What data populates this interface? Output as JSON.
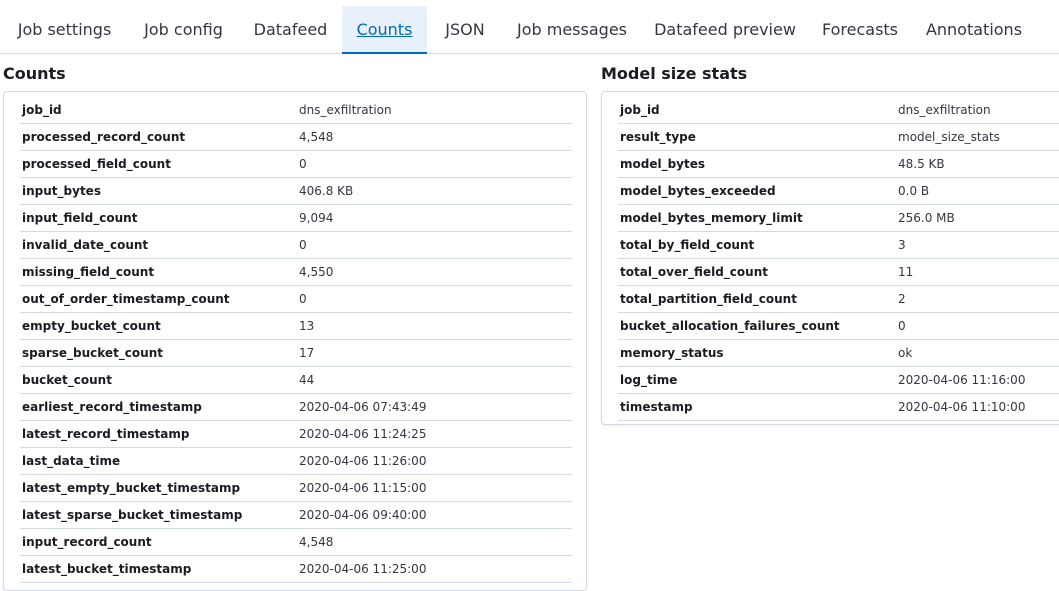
{
  "tabs": [
    {
      "label": "Job settings"
    },
    {
      "label": "Job config"
    },
    {
      "label": "Datafeed"
    },
    {
      "label": "Counts",
      "selected": true
    },
    {
      "label": "JSON"
    },
    {
      "label": "Job messages"
    },
    {
      "label": "Datafeed preview"
    },
    {
      "label": "Forecasts"
    },
    {
      "label": "Annotations"
    }
  ],
  "counts": {
    "title": "Counts",
    "rows": [
      {
        "key": "job_id",
        "value": "dns_exfiltration"
      },
      {
        "key": "processed_record_count",
        "value": "4,548"
      },
      {
        "key": "processed_field_count",
        "value": "0"
      },
      {
        "key": "input_bytes",
        "value": "406.8 KB"
      },
      {
        "key": "input_field_count",
        "value": "9,094"
      },
      {
        "key": "invalid_date_count",
        "value": "0"
      },
      {
        "key": "missing_field_count",
        "value": "4,550"
      },
      {
        "key": "out_of_order_timestamp_count",
        "value": "0"
      },
      {
        "key": "empty_bucket_count",
        "value": "13"
      },
      {
        "key": "sparse_bucket_count",
        "value": "17"
      },
      {
        "key": "bucket_count",
        "value": "44"
      },
      {
        "key": "earliest_record_timestamp",
        "value": "2020-04-06 07:43:49"
      },
      {
        "key": "latest_record_timestamp",
        "value": "2020-04-06 11:24:25"
      },
      {
        "key": "last_data_time",
        "value": "2020-04-06 11:26:00"
      },
      {
        "key": "latest_empty_bucket_timestamp",
        "value": "2020-04-06 11:15:00"
      },
      {
        "key": "latest_sparse_bucket_timestamp",
        "value": "2020-04-06 09:40:00"
      },
      {
        "key": "input_record_count",
        "value": "4,548"
      },
      {
        "key": "latest_bucket_timestamp",
        "value": "2020-04-06 11:25:00"
      }
    ]
  },
  "model_size_stats": {
    "title": "Model size stats",
    "rows": [
      {
        "key": "job_id",
        "value": "dns_exfiltration"
      },
      {
        "key": "result_type",
        "value": "model_size_stats"
      },
      {
        "key": "model_bytes",
        "value": "48.5 KB"
      },
      {
        "key": "model_bytes_exceeded",
        "value": "0.0 B"
      },
      {
        "key": "model_bytes_memory_limit",
        "value": "256.0 MB"
      },
      {
        "key": "total_by_field_count",
        "value": "3"
      },
      {
        "key": "total_over_field_count",
        "value": "11"
      },
      {
        "key": "total_partition_field_count",
        "value": "2"
      },
      {
        "key": "bucket_allocation_failures_count",
        "value": "0"
      },
      {
        "key": "memory_status",
        "value": "ok"
      },
      {
        "key": "log_time",
        "value": "2020-04-06 11:16:00"
      },
      {
        "key": "timestamp",
        "value": "2020-04-06 11:10:00"
      }
    ]
  },
  "colors": {
    "accent": "#006bb8",
    "selected_tab_bg": "#e8f1fa",
    "border": "#d3dae6"
  }
}
